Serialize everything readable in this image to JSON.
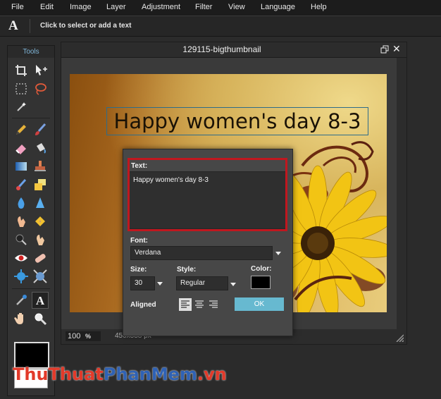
{
  "menu": [
    "File",
    "Edit",
    "Image",
    "Layer",
    "Adjustment",
    "Filter",
    "View",
    "Language",
    "Help"
  ],
  "options_bar": {
    "tool_icon": "text-tool-icon",
    "tool_glyph": "A",
    "hint": "Click to select or add a text"
  },
  "tools_panel": {
    "title": "Tools",
    "tools": [
      "crop",
      "move",
      "marquee",
      "lasso",
      "magic-wand",
      "pencil",
      "brush",
      "eraser",
      "bucket",
      "gradient",
      "clone-stamp",
      "color-replace",
      "picture",
      "blur",
      "sharpen",
      "smudge",
      "sponge",
      "burn",
      "dodge",
      "red-eye",
      "spot-heal",
      "bloat",
      "pinch",
      "color-picker",
      "type",
      "hand",
      "zoom"
    ],
    "foreground_color": "#000000",
    "background_color": "#ffffff"
  },
  "document": {
    "title": "129115-bigthumbnail",
    "canvas_text": "Happy women's day 8-3",
    "zoom": "100",
    "zoom_unit": "%",
    "size_text": "450x338 px"
  },
  "text_dialog": {
    "text_label": "Text:",
    "text_value": "Happy women's day 8-3",
    "font_label": "Font:",
    "font_value": "Verdana",
    "size_label": "Size:",
    "size_value": "30",
    "style_label": "Style:",
    "style_value": "Regular",
    "color_label": "Color:",
    "color_value": "#000000",
    "aligned_label": "Aligned",
    "align_selected": "left",
    "ok_label": "OK"
  },
  "watermark": {
    "part1": "ThuThuat",
    "part2": "PhanMem",
    "part3": ".vn"
  },
  "colors": {
    "accent": "#67b9d0",
    "highlight": "#c0171f",
    "tools_title": "#7fb5d8"
  }
}
